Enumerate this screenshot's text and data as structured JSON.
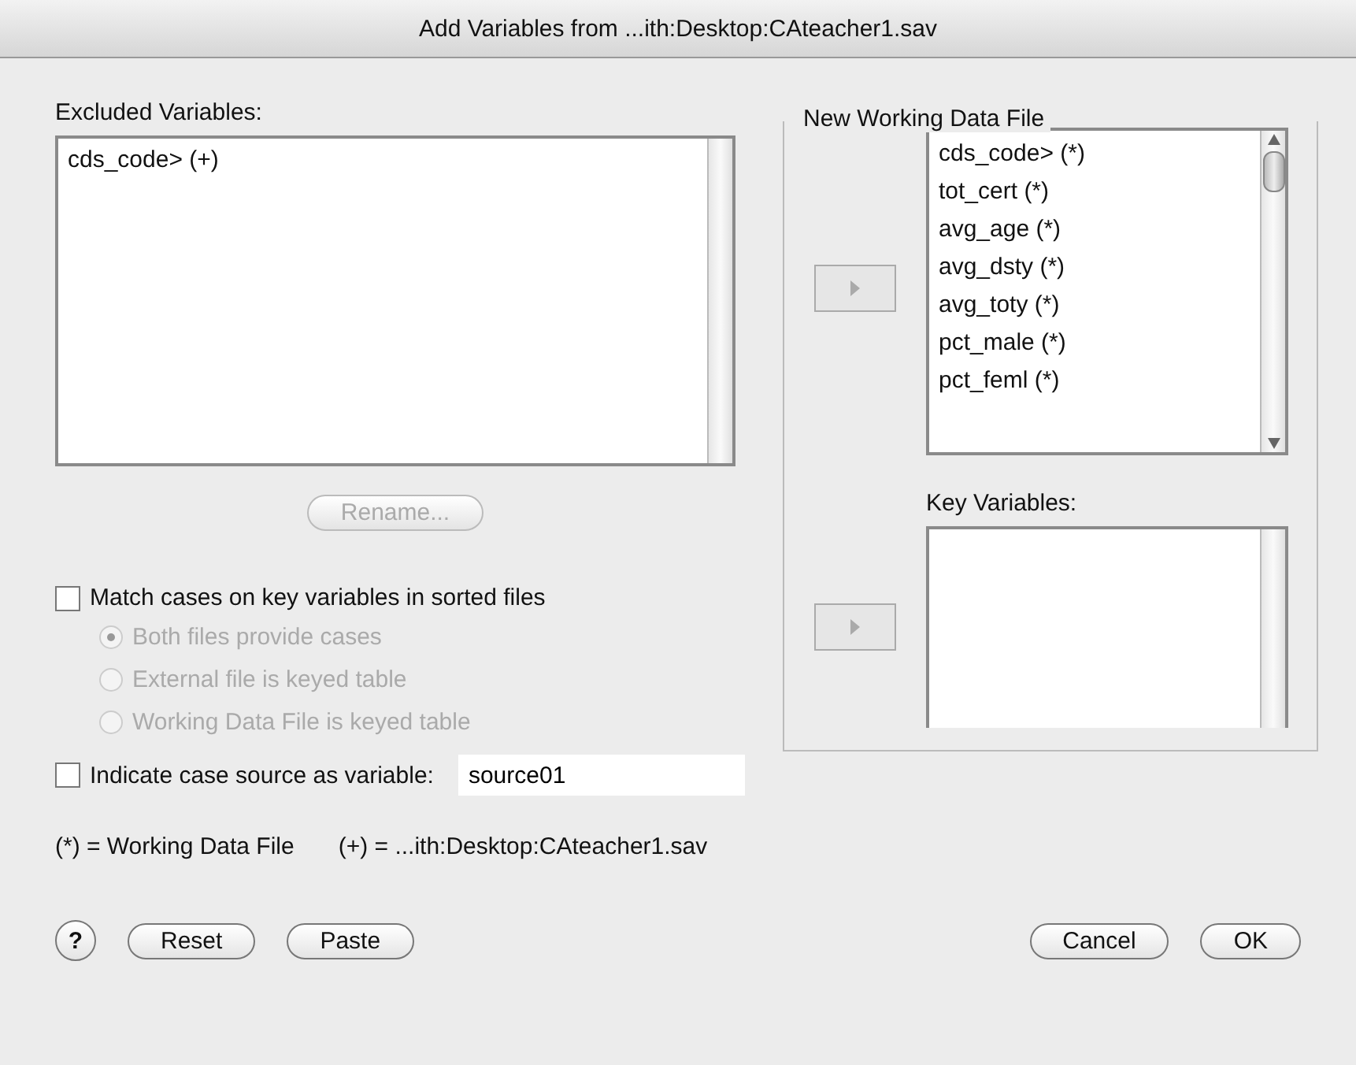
{
  "window": {
    "title": "Add Variables from ...ith:Desktop:CAteacher1.sav"
  },
  "excluded": {
    "label": "Excluded Variables:",
    "items": [
      "cds_code> (+)"
    ]
  },
  "rename_button": {
    "label": "Rename...",
    "disabled": true
  },
  "match": {
    "label": "Match cases on key variables in sorted files",
    "checked": false
  },
  "radios": [
    {
      "label": "Both files provide cases",
      "selected": true,
      "disabled": true
    },
    {
      "label": "External file is keyed table",
      "selected": false,
      "disabled": true
    },
    {
      "label": "Working Data File is keyed table",
      "selected": false,
      "disabled": true
    }
  ],
  "case_source": {
    "label": "Indicate case source as variable:",
    "checked": false,
    "value": "source01"
  },
  "legend": [
    "(*) = Working Data File",
    "(+) = ...ith:Desktop:CAteacher1.sav"
  ],
  "new_file": {
    "title": "New Working Data File",
    "items": [
      "cds_code> (*)",
      "tot_cert (*)",
      "avg_age (*)",
      "avg_dsty (*)",
      "avg_toty (*)",
      "pct_male (*)",
      "pct_feml (*)"
    ]
  },
  "key_variables": {
    "label": "Key Variables:"
  },
  "buttons_left": [
    {
      "kind": "help",
      "label": "?"
    },
    {
      "kind": "push",
      "label": "Reset"
    },
    {
      "kind": "push",
      "label": "Paste"
    }
  ],
  "buttons_right": [
    {
      "kind": "push",
      "label": "Cancel"
    },
    {
      "kind": "push",
      "label": "OK"
    }
  ]
}
